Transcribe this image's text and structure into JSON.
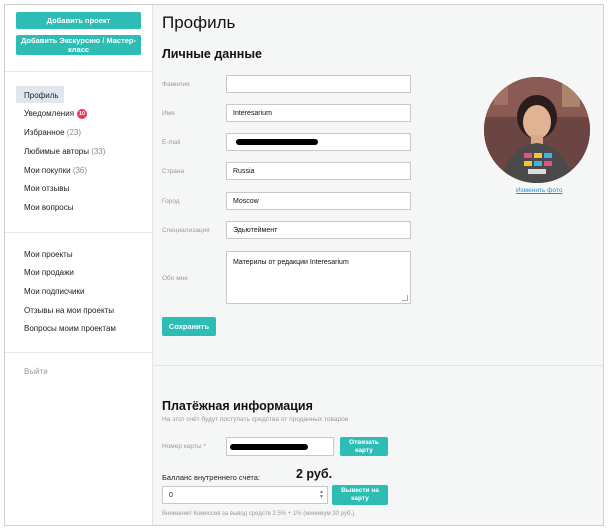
{
  "sidebar": {
    "add_project": "Добавить проект",
    "add_excursion": "Добавить Экскурсию / Мастер-класс",
    "items": [
      {
        "label": "Профиль"
      },
      {
        "label": "Уведомления",
        "badge": "10"
      },
      {
        "label": "Избранное",
        "count": "(23)"
      },
      {
        "label": "Любимые авторы",
        "count": "(33)"
      },
      {
        "label": "Мои покупки",
        "count": "(36)"
      },
      {
        "label": "Мои отзывы"
      },
      {
        "label": "Мои вопросы"
      }
    ],
    "items2": [
      {
        "label": "Мои проекты"
      },
      {
        "label": "Мои продажи"
      },
      {
        "label": "Мои подписчики"
      },
      {
        "label": "Отзывы на мои проекты"
      },
      {
        "label": "Вопросы моим проектам"
      }
    ],
    "logout": "Выйти"
  },
  "profile": {
    "title": "Профиль",
    "section": "Личные данные",
    "fields": {
      "lastname": {
        "label": "Фамилия",
        "value": ""
      },
      "name": {
        "label": "Имя",
        "value": "Interesarium"
      },
      "email": {
        "label": "E-mail",
        "value": ""
      },
      "country": {
        "label": "Страна",
        "value": "Russia"
      },
      "city": {
        "label": "Город",
        "value": "Moscow"
      },
      "specialization": {
        "label": "Специализация",
        "value": "Эдьютеймент"
      },
      "about": {
        "label": "Обо мне",
        "value": "Материлы от редакции Interesarium"
      }
    },
    "save": "Сохранить",
    "change_photo": "Изменить фото"
  },
  "payment": {
    "title": "Платёжная информация",
    "subtitle": "На этот счёт будут поступать средства от проданных товаров",
    "card_label": "Номер карты *",
    "unlink": "Отвязать карту",
    "balance_label": "Балланс внутреннего счета:",
    "balance_value": "2 руб.",
    "amount": "0",
    "withdraw": "Вывести на карту",
    "note": "Внимание! Комиссия за вывод средств 2.5% + 1% (минимум 30 руб.)."
  },
  "colors": {
    "accent": "#2ebdb5",
    "badge": "#e73b5a",
    "link": "#2a8ec6"
  }
}
